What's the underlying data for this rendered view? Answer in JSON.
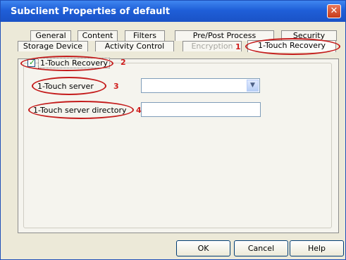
{
  "window": {
    "title": "Subclient Properties of default",
    "close_glyph": "✕"
  },
  "tabs_row1": [
    {
      "label": "General"
    },
    {
      "label": "Content"
    },
    {
      "label": "Filters"
    },
    {
      "label": "Pre/Post Process"
    },
    {
      "label": "Security"
    }
  ],
  "tabs_row2": [
    {
      "label": "Storage Device"
    },
    {
      "label": "Activity Control"
    },
    {
      "label": "Encryption",
      "disabled": true
    },
    {
      "label": "1-Touch Recovery",
      "active": true
    }
  ],
  "form": {
    "checkbox_label": "1-Touch Recovery",
    "checkbox_checked": true,
    "server_label": "1-Touch server",
    "server_value": "",
    "directory_label": "1-Touch server directory",
    "directory_value": ""
  },
  "annotations": {
    "n1": "1",
    "n2": "2",
    "n3": "3",
    "n4": "4",
    "color": "#d01c1c"
  },
  "buttons": {
    "ok": "OK",
    "cancel": "Cancel",
    "help": "Help"
  }
}
